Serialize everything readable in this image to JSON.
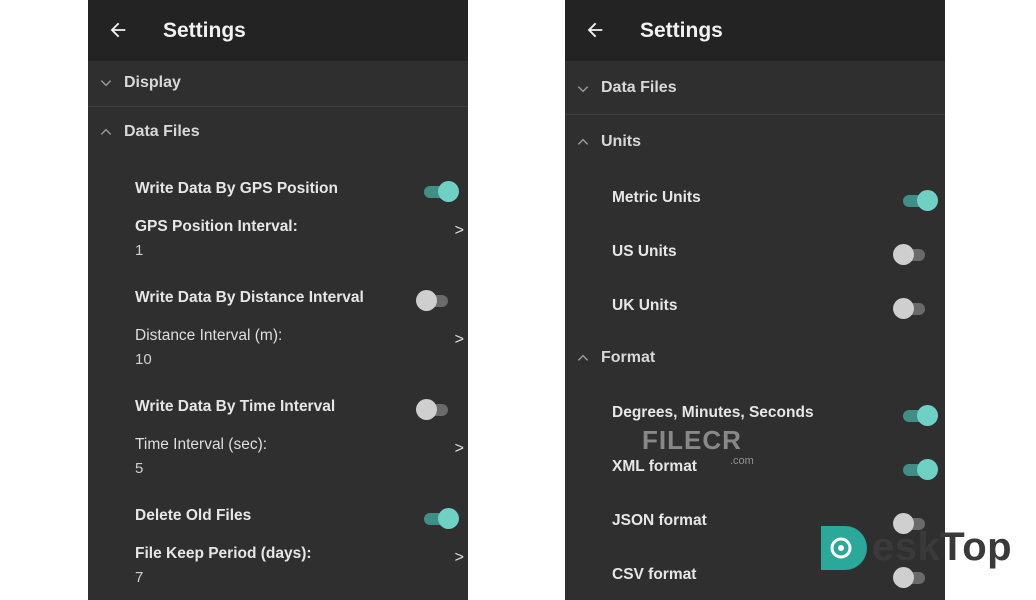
{
  "colors": {
    "appbar": "#232323",
    "background": "#2f2f2f",
    "accent": "#6fd1c4",
    "watermark": "#2aa89a"
  },
  "left_screen": {
    "title": "Settings",
    "sections": [
      {
        "label": "Display",
        "expanded": false
      },
      {
        "label": "Data Files",
        "expanded": true
      }
    ],
    "items": [
      {
        "label": "Write Data By GPS Position",
        "type": "switch",
        "on": true
      },
      {
        "label": "GPS Position Interval:",
        "type": "value",
        "value": "1"
      },
      {
        "label": "Write Data By Distance Interval",
        "type": "switch",
        "on": false
      },
      {
        "label": "Distance Interval (m):",
        "type": "value",
        "value": "10"
      },
      {
        "label": "Write Data By Time Interval",
        "type": "switch",
        "on": false
      },
      {
        "label": "Time Interval (sec):",
        "type": "value",
        "value": "5"
      },
      {
        "label": "Delete Old Files",
        "type": "switch",
        "on": true
      },
      {
        "label": "File Keep Period (days):",
        "type": "value",
        "value": "7"
      }
    ],
    "chevron": ">"
  },
  "right_screen": {
    "title": "Settings",
    "sections": [
      {
        "label": "Data Files",
        "expanded": false
      },
      {
        "label": "Units",
        "expanded": true
      },
      {
        "label": "Format",
        "expanded": true
      }
    ],
    "units_items": [
      {
        "label": "Metric Units",
        "on": true
      },
      {
        "label": "US Units",
        "on": false
      },
      {
        "label": "UK Units",
        "on": false
      }
    ],
    "format_items": [
      {
        "label": "Degrees, Minutes, Seconds",
        "on": true
      },
      {
        "label": "XML format",
        "on": true
      },
      {
        "label": "JSON format",
        "on": false
      },
      {
        "label": "CSV format",
        "on": false
      }
    ]
  },
  "watermarks": {
    "filecr": "FILECR",
    "filecr_suffix": ".com",
    "desktop": "eskTop"
  }
}
